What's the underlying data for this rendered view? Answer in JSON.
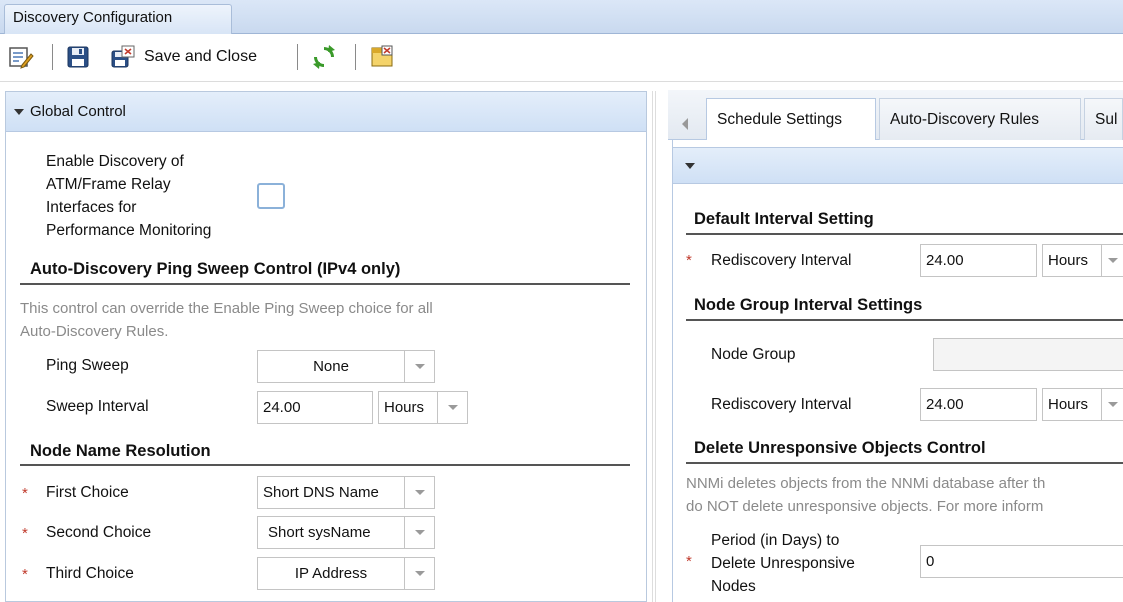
{
  "window": {
    "title": "Discovery Configuration"
  },
  "toolbar": {
    "edit_icon": "edit-form-icon",
    "save_icon": "floppy-disk-icon",
    "save_close_icon": "save-close-icon",
    "save_close_label": "Save and Close",
    "refresh_icon": "refresh-icon",
    "close_icon": "close-form-icon"
  },
  "left": {
    "global_control": {
      "title": "Global Control"
    },
    "atm": {
      "label_lines": [
        "Enable Discovery of",
        "ATM/Frame Relay",
        "Interfaces for",
        "Performance Monitoring"
      ],
      "checked": false
    },
    "ping_sweep_control": {
      "title": "Auto-Discovery Ping Sweep Control (IPv4 only)",
      "desc_line1": "This control can override the Enable Ping Sweep choice for all",
      "desc_line2": "Auto-Discovery Rules.",
      "ping_sweep_label": "Ping Sweep",
      "ping_sweep_value": "None",
      "sweep_interval_label": "Sweep Interval",
      "sweep_interval_value": "24.00",
      "sweep_interval_unit": "Hours"
    },
    "node_name_resolution": {
      "title": "Node Name Resolution",
      "required_mark": "*",
      "first_label": "First Choice",
      "first_value": "Short DNS Name",
      "second_label": "Second Choice",
      "second_value": "Short sysName",
      "third_label": "Third Choice",
      "third_value": "IP Address"
    }
  },
  "right": {
    "tabs": [
      "Schedule Settings",
      "Auto-Discovery Rules",
      "Sul"
    ],
    "active_tab": "Schedule Settings",
    "default_interval": {
      "title": "Default Interval Setting",
      "required_mark": "*",
      "label": "Rediscovery Interval",
      "value": "24.00",
      "unit": "Hours"
    },
    "node_group_interval": {
      "title": "Node Group Interval Settings",
      "node_group_label": "Node Group",
      "node_group_value": "",
      "label": "Rediscovery Interval",
      "value": "24.00",
      "unit": "Hours"
    },
    "delete_unresponsive": {
      "title": "Delete Unresponsive Objects Control",
      "desc_line1": "NNMi deletes objects from the NNMi database after th",
      "desc_line2": "do NOT delete unresponsive objects. For more inform",
      "required_mark": "*",
      "label_lines": [
        "Period (in Days) to",
        "Delete Unresponsive",
        "Nodes"
      ],
      "value": "0"
    }
  },
  "colors": {
    "header_gradient_top": "#e4eefa",
    "header_gradient_bottom": "#cfe0f5",
    "required": "#c0392b",
    "refresh_green": "#3a9a2a"
  }
}
